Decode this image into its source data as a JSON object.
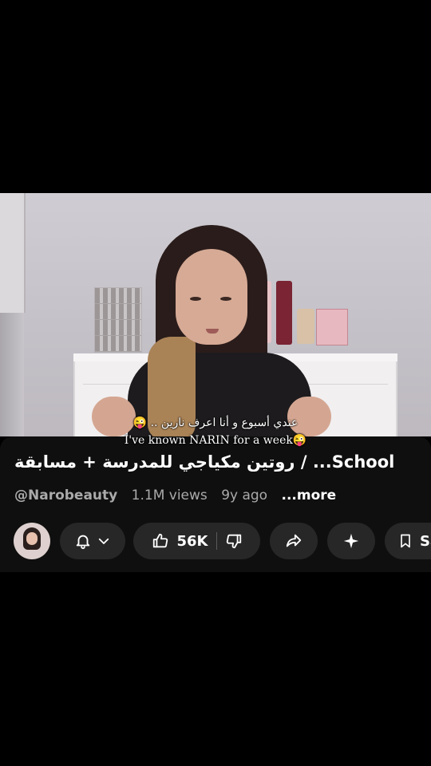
{
  "subtitles": {
    "arabic": "عندي أسبوع و أنا اعرف نارين .. 😜",
    "english": "I've known NARIN for a week😜"
  },
  "video": {
    "title": "روتين مكياجي للمدرسة + مسابقة / ...School",
    "channel": "@Narobeauty",
    "views": "1.1M views",
    "age": "9y ago",
    "more": "...more"
  },
  "actions": {
    "likes": "56K",
    "save_label": "Sa",
    "icons": [
      "bell-icon",
      "chevron-down-icon",
      "thumbs-up-icon",
      "thumbs-down-icon",
      "share-icon",
      "sparkle-icon",
      "bookmark-icon"
    ]
  },
  "colors": {
    "background": "#000000",
    "panel": "#0f0f0f",
    "pill": "#272727",
    "muted_text": "#aaaaaa"
  }
}
